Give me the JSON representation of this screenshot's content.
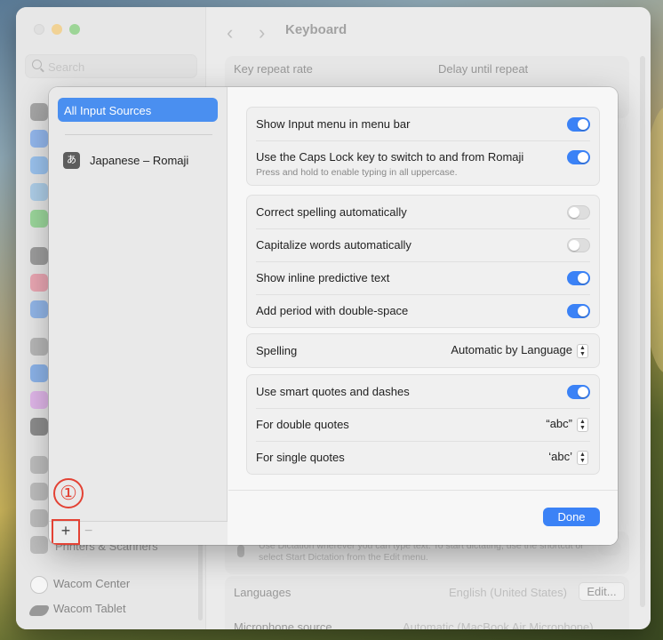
{
  "window": {
    "title": "Keyboard"
  },
  "sidebar": {
    "search_placeholder": "Search",
    "bottom_items": [
      {
        "label": "Printers & Scanners"
      },
      {
        "label": "Wacom Center"
      },
      {
        "label": "Wacom Tablet"
      }
    ]
  },
  "background": {
    "key_repeat_rate": "Key repeat rate",
    "delay_until_repeat": "Delay until repeat",
    "dictation_hint": "Use Dictation wherever you can type text. To start dictating, use the shortcut or select Start Dictation from the Edit menu.",
    "languages_label": "Languages",
    "languages_value": "English (United States)",
    "edit_button": "Edit...",
    "microphone_label": "Microphone source",
    "microphone_value": "Automatic (MacBook Air Microphone)"
  },
  "sheet": {
    "sources": {
      "all_label": "All Input Sources",
      "items": [
        {
          "badge": "あ",
          "label": "Japanese – Romaji"
        }
      ]
    },
    "toolbar": {
      "add": "+",
      "remove": "−"
    },
    "annotation": "①",
    "groups": [
      {
        "rows": [
          {
            "label": "Show Input menu in menu bar",
            "toggle": true
          },
          {
            "label": "Use the Caps Lock key to switch to and from Romaji",
            "sub": "Press and hold to enable typing in all uppercase.",
            "toggle": true
          }
        ]
      },
      {
        "rows": [
          {
            "label": "Correct spelling automatically",
            "toggle": false
          },
          {
            "label": "Capitalize words automatically",
            "toggle": false
          },
          {
            "label": "Show inline predictive text",
            "toggle": true
          },
          {
            "label": "Add period with double-space",
            "toggle": true
          }
        ]
      },
      {
        "rows": [
          {
            "label": "Spelling",
            "value": "Automatic by Language"
          }
        ]
      },
      {
        "rows": [
          {
            "label": "Use smart quotes and dashes",
            "toggle": true
          },
          {
            "label": "For double quotes",
            "value": "“abc”"
          },
          {
            "label": "For single quotes",
            "value": "‘abc’"
          }
        ]
      }
    ],
    "done_label": "Done"
  },
  "colors": {
    "accent": "#3b82f6",
    "annotation": "#e34234"
  }
}
